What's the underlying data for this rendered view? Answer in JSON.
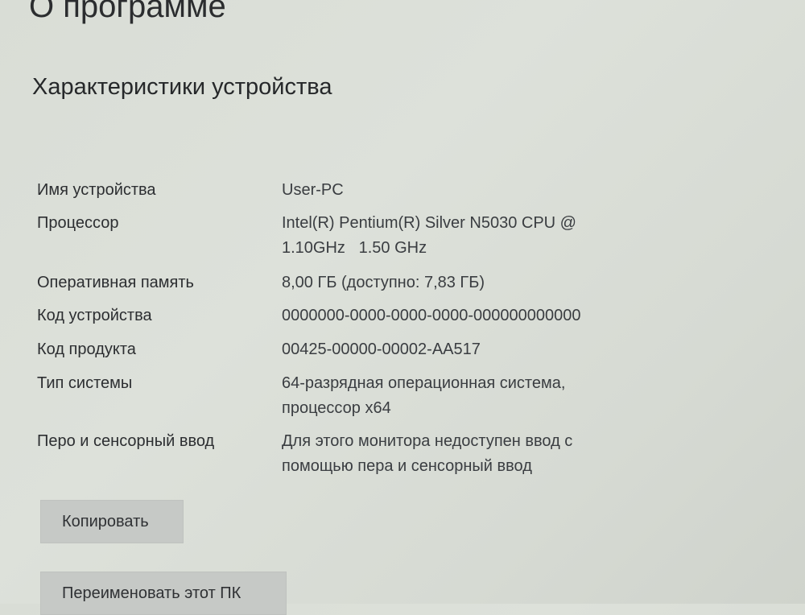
{
  "header": {
    "title": "О программе"
  },
  "device_specs": {
    "section_title": "Характеристики устройства",
    "rows": [
      {
        "label": "Имя устройства",
        "value": "User-PC"
      },
      {
        "label": "Процессор",
        "value": "Intel(R) Pentium(R) Silver N5030 CPU @\n1.10GHz   1.50 GHz"
      },
      {
        "label": "Оперативная память",
        "value": "8,00 ГБ (доступно: 7,83 ГБ)"
      },
      {
        "label": "Код устройства",
        "value": "0000000-0000-0000-0000-000000000000"
      },
      {
        "label": "Код продукта",
        "value": "00425-00000-00002-AA517"
      },
      {
        "label": "Тип системы",
        "value": "64-разрядная операционная система,\nпроцессор x64"
      },
      {
        "label": "Перо и сенсорный ввод",
        "value": "Для этого монитора недоступен ввод с\nпомощью пера и сенсорный ввод"
      }
    ]
  },
  "buttons": {
    "copy_label": "Копировать",
    "rename_label": "Переименовать этот ПК"
  }
}
